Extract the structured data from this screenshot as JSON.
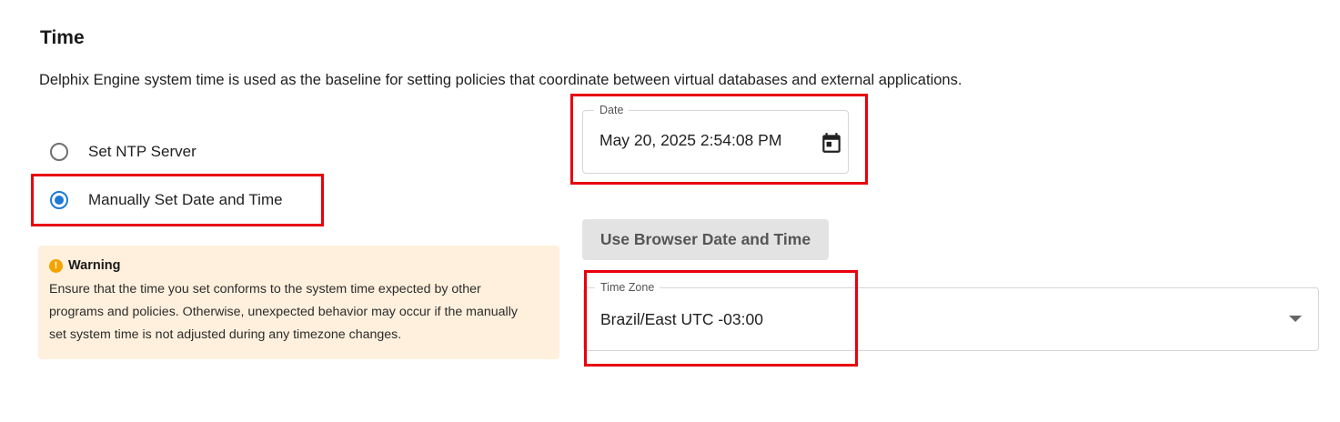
{
  "section": {
    "title": "Time",
    "description": "Delphix Engine system time is used as the baseline for setting policies that coordinate between virtual databases and external applications."
  },
  "time_source": {
    "options": [
      {
        "label": "Set NTP Server",
        "selected": false
      },
      {
        "label": "Manually Set Date and Time",
        "selected": true
      }
    ]
  },
  "warning": {
    "icon": "warning-icon",
    "icon_glyph": "!",
    "title": "Warning",
    "lines": [
      "Ensure that the time you set conforms to the system time expected by other",
      "programs and policies. Otherwise, unexpected behavior may occur if the manually",
      "set system time is not adjusted during any timezone changes."
    ]
  },
  "date_field": {
    "label": "Date",
    "value": "May 20, 2025 2:54:08 PM",
    "icon": "calendar-icon"
  },
  "browser_button": {
    "label": "Use Browser Date and Time"
  },
  "timezone_field": {
    "label": "Time Zone",
    "value": "Brazil/East UTC -03:00",
    "icon": "chevron-down-icon"
  },
  "colors": {
    "accent": "#1e7ad6",
    "highlight": "#e8000b",
    "warning_bg": "#fff0dd",
    "warning_icon": "#f2a400",
    "button_bg": "#e3e3e3"
  }
}
